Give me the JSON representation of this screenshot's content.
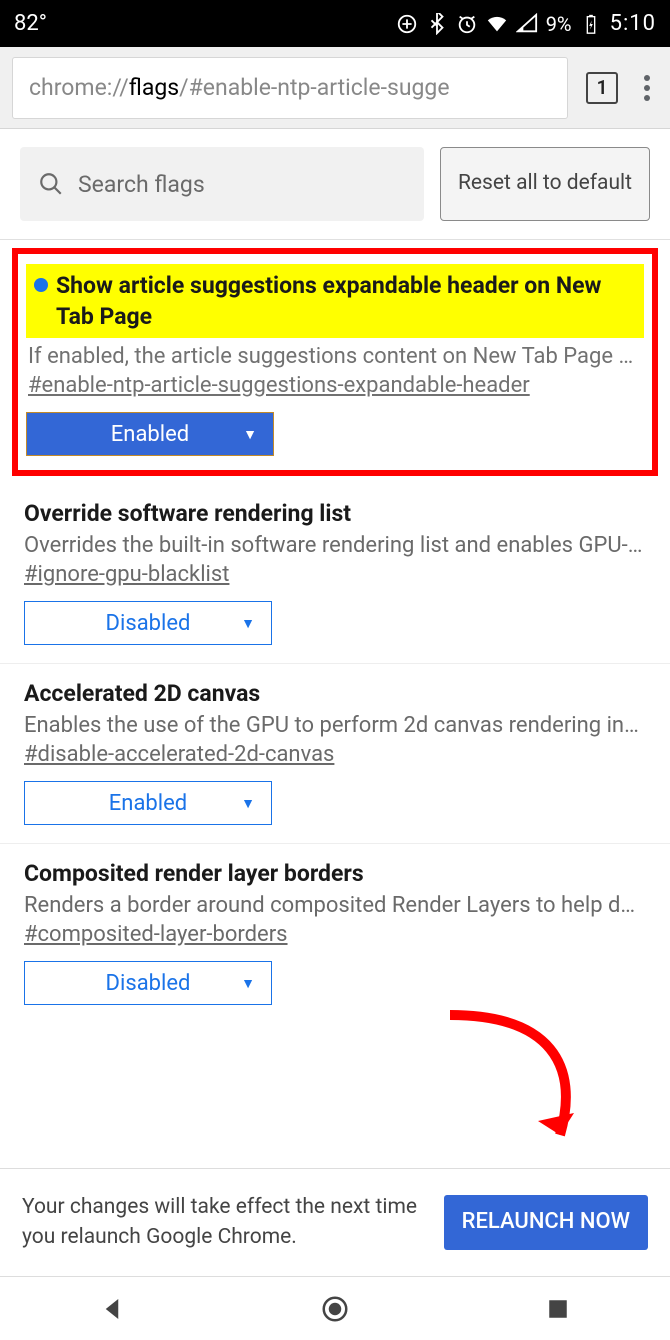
{
  "status": {
    "temp": "82°",
    "battery_pct": "9%",
    "time": "5:10"
  },
  "omnibox": {
    "url_grey1": "chrome://",
    "url_black": "flags",
    "url_grey2": "/#enable-ntp-article-sugge",
    "tab_count": "1"
  },
  "search": {
    "placeholder": "Search flags",
    "reset_label": "Reset all to default"
  },
  "flags": [
    {
      "title": "Show article suggestions expandable header on New Tab Page",
      "desc": "If enabled, the article suggestions content on New Tab Page c…",
      "id": "#enable-ntp-article-suggestions-expandable-header",
      "select": "Enabled",
      "highlighted": true,
      "enabled_style": true
    },
    {
      "title": "Override software rendering list",
      "desc": "Overrides the built-in software rendering list and enables GPU-…",
      "id": "#ignore-gpu-blacklist",
      "select": "Disabled"
    },
    {
      "title": "Accelerated 2D canvas",
      "desc": "Enables the use of the GPU to perform 2d canvas rendering in…",
      "id": "#disable-accelerated-2d-canvas",
      "select": "Enabled"
    },
    {
      "title": "Composited render layer borders",
      "desc": "Renders a border around composited Render Layers to help d…",
      "id": "#composited-layer-borders",
      "select": "Disabled"
    }
  ],
  "relaunch": {
    "text": "Your changes will take effect the next time you relaunch Google Chrome.",
    "button": "RELAUNCH NOW"
  }
}
